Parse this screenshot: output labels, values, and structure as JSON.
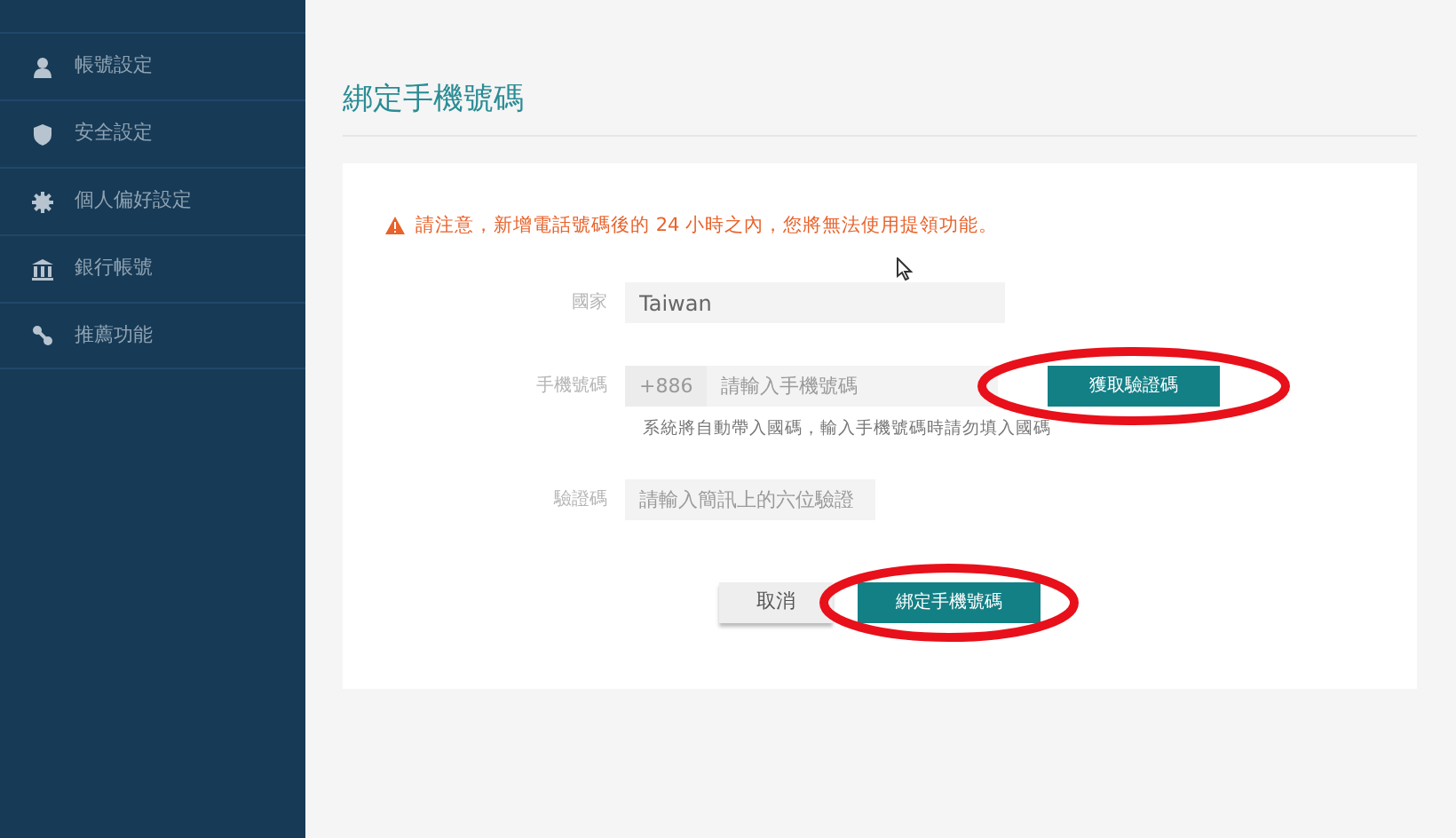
{
  "sidebar": {
    "items": [
      {
        "label": "帳號設定"
      },
      {
        "label": "安全設定"
      },
      {
        "label": "個人偏好設定"
      },
      {
        "label": "銀行帳號"
      },
      {
        "label": "推薦功能"
      }
    ]
  },
  "page_title": "綁定手機號碼",
  "warning": "請注意，新增電話號碼後的 24 小時之內，您將無法使用提領功能。",
  "form": {
    "country": {
      "label": "國家",
      "value": "Taiwan"
    },
    "phone": {
      "label": "手機號碼",
      "prefix": "+886",
      "placeholder": "請輸入手機號碼",
      "button": "獲取驗證碼",
      "circled": true,
      "help": "系統將自動帶入國碼，輸入手機號碼時請勿填入國碼"
    },
    "code": {
      "label": "驗證碼",
      "placeholder": "請輸入簡訊上的六位驗證"
    }
  },
  "actions": [
    {
      "label": "取消",
      "kind": "secondary",
      "circled": false
    },
    {
      "label": "綁定手機號碼",
      "kind": "primary",
      "circled": true
    }
  ]
}
